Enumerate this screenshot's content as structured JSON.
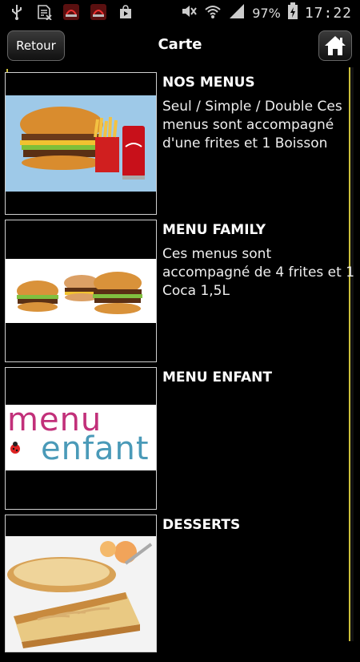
{
  "status_bar": {
    "battery": "97%",
    "time": "17:22",
    "icons": [
      "usb-icon",
      "sim-error-icon",
      "app-notification-icon",
      "app-notification-icon",
      "play-store-icon",
      "mute-icon",
      "wifi-icon",
      "signal-icon",
      "battery-icon"
    ]
  },
  "header": {
    "back_label": "Retour",
    "title": "Carte",
    "home_icon": "home-icon"
  },
  "items": [
    {
      "title": "NOS MENUS",
      "desc": "Seul / Simple / Double Ces menus sont accompagné d'une frites et 1 Boisson"
    },
    {
      "title": "MENU FAMILY",
      "desc": "Ces menus sont accompagné de 4 frites et 1 Coca 1,5L"
    },
    {
      "title": "MENU ENFANT",
      "desc": ""
    },
    {
      "title": "DESSERTS",
      "desc": ""
    }
  ],
  "images": {
    "menu_enfant_logo_line1": "menu",
    "menu_enfant_logo_line2": "enfant"
  },
  "colors": {
    "accent": "#cbbf3a",
    "background": "#000000"
  }
}
